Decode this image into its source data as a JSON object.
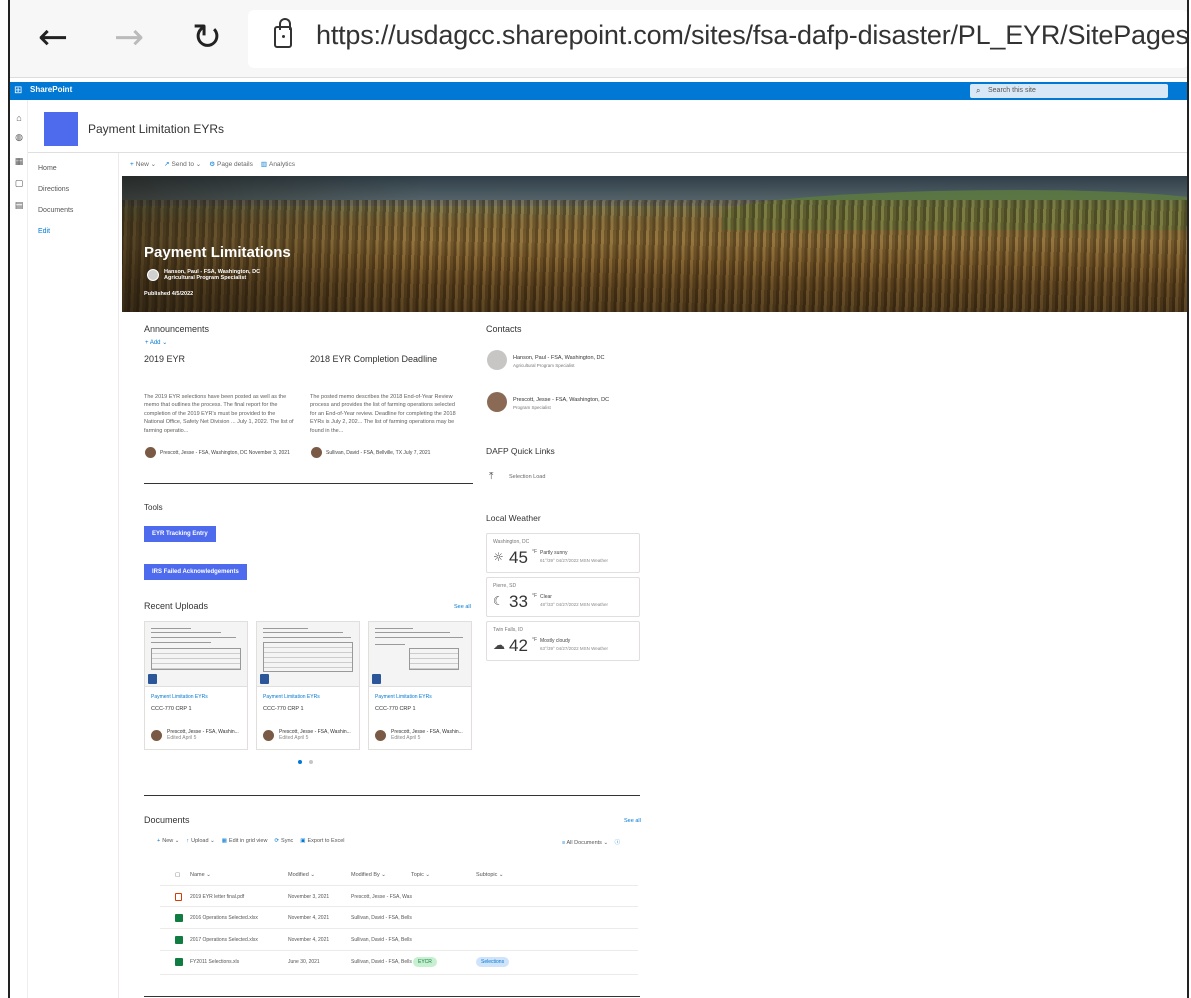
{
  "browser": {
    "url": "https://usdagcc.sharepoint.com/sites/fsa-dafp-disaster/PL_EYR/SitePages/Home.aspx",
    "back_glyph": "←",
    "forward_glyph": "→",
    "reload_glyph": "↻"
  },
  "suite": {
    "brand": "SharePoint",
    "search_placeholder": "Search this site"
  },
  "site": {
    "title": "Payment Limitation EYRs",
    "logo_color": "#4f6bed"
  },
  "nav": {
    "items": [
      "Home",
      "Directions",
      "Documents"
    ],
    "edit": "Edit"
  },
  "commandbar": {
    "new": "New",
    "send_to": "Send to",
    "page_details": "Page details",
    "analytics": "Analytics"
  },
  "hero": {
    "title": "Payment Limitations",
    "author_name": "Hanson, Paul - FSA, Washington, DC",
    "author_role": "Agricultural Program Specialist",
    "published": "Published 4/5/2022"
  },
  "announcements": {
    "title": "Announcements",
    "add": "Add",
    "items": [
      {
        "heading": "2019 EYR",
        "body": "The 2019 EYR selections have been posted as well as the memo that outlines the process. The final report for the completion of the 2019 EYR's must be provided to the National Office, Safety Net Division ... July 1, 2022. The list of farming operatio...",
        "meta": "Prescott, Jesse - FSA, Washington, DC November 3, 2021"
      },
      {
        "heading": "2018 EYR Completion Deadline",
        "body": "The posted memo describes the 2018 End-of-Year Review process and provides the list of farming operations selected for an End-of-Year review. Deadline for completing the 2018 EYRs is July 2, 202... The list of farming operations may be found in the...",
        "meta": "Sullivan, David - FSA, Bellville, TX July 7, 2021"
      }
    ]
  },
  "tools": {
    "title": "Tools",
    "buttons": [
      "EYR Tracking Entry",
      "IRS Failed Acknowledgements"
    ]
  },
  "uploads": {
    "title": "Recent Uploads",
    "see_all": "See all",
    "cards": [
      {
        "site": "Payment Limitation EYRs",
        "name": "CCC-770 CRP 1",
        "user": "Prescott, Jesse - FSA, Washin...",
        "edited": "Edited April 5"
      },
      {
        "site": "Payment Limitation EYRs",
        "name": "CCC-770 CRP 1",
        "user": "Prescott, Jesse - FSA, Washin...",
        "edited": "Edited April 5"
      },
      {
        "site": "Payment Limitation EYRs",
        "name": "CCC-770 CRP 1",
        "user": "Prescott, Jesse - FSA, Washin...",
        "edited": "Edited April 5"
      }
    ]
  },
  "documents": {
    "title": "Documents",
    "see_all": "See all",
    "commands": {
      "new": "New",
      "upload": "Upload",
      "grid": "Edit in grid view",
      "sync": "Sync",
      "export": "Export to Excel"
    },
    "view": "All Documents",
    "columns": [
      "Name",
      "Modified",
      "Modified By",
      "Topic",
      "Subtopic"
    ],
    "rows": [
      {
        "type": "pdf",
        "name": "2019 EYR letter final.pdf",
        "modified": "November 3, 2021",
        "by": "Prescott, Jesse - FSA, Was",
        "topic": "",
        "subtopic": ""
      },
      {
        "type": "xls",
        "name": "2016 Operations Selected.xlsx",
        "modified": "November 4, 2021",
        "by": "Sullivan, David - FSA, Bells",
        "topic": "",
        "subtopic": ""
      },
      {
        "type": "xls",
        "name": "2017 Operations Selected.xlsx",
        "modified": "November 4, 2021",
        "by": "Sullivan, David - FSA, Bells",
        "topic": "",
        "subtopic": ""
      },
      {
        "type": "xls",
        "name": "FY2011 Selections.xls",
        "modified": "June 30, 2021",
        "by": "Sullivan, David - FSA, Bells",
        "topic": "EYCR",
        "subtopic": "Selections"
      }
    ]
  },
  "contacts": {
    "title": "Contacts",
    "people": [
      {
        "name": "Hanson, Paul - FSA, Washington, DC",
        "role": "Agricultural Program Specialist"
      },
      {
        "name": "Prescott, Jesse - FSA, Washington, DC",
        "role": "Program Specialist"
      }
    ]
  },
  "quicklinks": {
    "title": "DAFP Quick Links",
    "items": [
      "Selection Load"
    ]
  },
  "weather": {
    "title": "Local Weather",
    "cards": [
      {
        "city": "Washington, DC",
        "icon": "☼",
        "temp": "45",
        "unit": "°F",
        "cond": "Partly sunny",
        "meta": "61°/39°   04/27/2022   MSN Weather"
      },
      {
        "city": "Pierre, SD",
        "icon": "☾",
        "temp": "33",
        "unit": "°F",
        "cond": "Clear",
        "meta": "48°/33°   04/27/2022   MSN Weather"
      },
      {
        "city": "Twin Falls, ID",
        "icon": "☁",
        "temp": "42",
        "unit": "°F",
        "cond": "Mostly cloudy",
        "meta": "63°/39°   04/27/2022   MSN Weather"
      }
    ]
  }
}
